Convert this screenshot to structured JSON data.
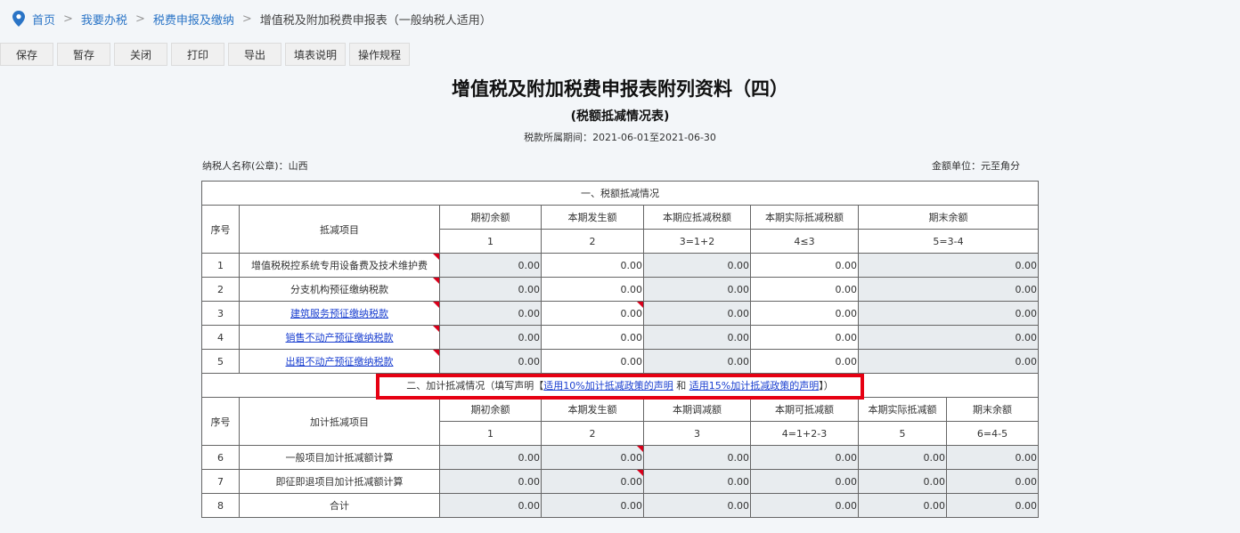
{
  "breadcrumb": {
    "items": [
      "首页",
      "我要办税",
      "税费申报及缴纳"
    ],
    "separator": ">",
    "current": "增值税及附加税费申报表（一般纳税人适用）"
  },
  "toolbar": {
    "save": "保存",
    "draft": "暂存",
    "close": "关闭",
    "print": "打印",
    "export": "导出",
    "fill_guide": "填表说明",
    "procedure": "操作规程"
  },
  "title": "增值税及附加税费申报表附列资料（四）",
  "subtitle": "(税额抵减情况表)",
  "period_label": "税款所属期间：",
  "period_value": "2021-06-01至2021-06-30",
  "taxpayer_label": "纳税人名称(公章)：山西",
  "unit_label": "金额单位：元至角分",
  "section1": {
    "title": "一、税额抵减情况",
    "headers": [
      "序号",
      "抵减项目",
      "期初余额",
      "本期发生额",
      "本期应抵减税额",
      "本期实际抵减税额",
      "期末余额"
    ],
    "formula": [
      "1",
      "2",
      "3=1+2",
      "4≤3",
      "5=3-4"
    ],
    "rows": [
      {
        "no": "1",
        "name": "增值税税控系统专用设备费及技术维护费",
        "link": false,
        "values": [
          "0.00",
          "0.00",
          "0.00",
          "0.00",
          "0.00"
        ]
      },
      {
        "no": "2",
        "name": "分支机构预征缴纳税款",
        "link": false,
        "values": [
          "0.00",
          "0.00",
          "0.00",
          "0.00",
          "0.00"
        ]
      },
      {
        "no": "3",
        "name": "建筑服务预征缴纳税款",
        "link": true,
        "values": [
          "0.00",
          "0.00",
          "0.00",
          "0.00",
          "0.00"
        ]
      },
      {
        "no": "4",
        "name": "销售不动产预征缴纳税款",
        "link": true,
        "values": [
          "0.00",
          "0.00",
          "0.00",
          "0.00",
          "0.00"
        ]
      },
      {
        "no": "5",
        "name": "出租不动产预征缴纳税款",
        "link": true,
        "values": [
          "0.00",
          "0.00",
          "0.00",
          "0.00",
          "0.00"
        ]
      }
    ]
  },
  "section2": {
    "title_prefix": "二、加计抵减情况（填写声明【",
    "link1": "适用10%加计抵减政策的声明",
    "and": " 和 ",
    "link2": "适用15%加计抵减政策的声明",
    "title_suffix": "】）",
    "headers": [
      "序号",
      "加计抵减项目",
      "期初余额",
      "本期发生额",
      "本期调减额",
      "本期可抵减额",
      "本期实际抵减额",
      "期末余额"
    ],
    "formula": [
      "1",
      "2",
      "3",
      "4=1+2-3",
      "5",
      "6=4-5"
    ],
    "rows": [
      {
        "no": "6",
        "name": "一般项目加计抵减额计算",
        "values": [
          "0.00",
          "0.00",
          "0.00",
          "0.00",
          "0.00",
          "0.00"
        ]
      },
      {
        "no": "7",
        "name": "即征即退项目加计抵减额计算",
        "values": [
          "0.00",
          "0.00",
          "0.00",
          "0.00",
          "0.00",
          "0.00"
        ]
      },
      {
        "no": "8",
        "name": "合计",
        "values": [
          "0.00",
          "0.00",
          "0.00",
          "0.00",
          "0.00",
          "0.00"
        ]
      }
    ]
  },
  "colors": {
    "link": "#2a74c6",
    "highlight_box": "#e60012",
    "corner_mark": "#d9001b"
  }
}
